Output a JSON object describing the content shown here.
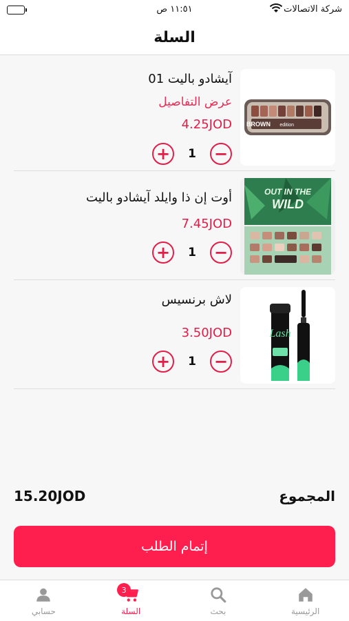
{
  "status_bar": {
    "carrier": "شركة الاتصالات",
    "time": "١١:٥١ ص"
  },
  "header": {
    "title": "السلة"
  },
  "cart_items": [
    {
      "name": "آيشادو باليت 01",
      "details_link": "عرض التفاصيل",
      "price": "4.25JOD",
      "quantity": "1",
      "image": "palette-brown-edition"
    },
    {
      "name": "أوت إن ذا وايلد آيشادو باليت",
      "price": "7.45JOD",
      "quantity": "1",
      "image": "palette-out-in-the-wild"
    },
    {
      "name": "لاش برنسيس",
      "price": "3.50JOD",
      "quantity": "1",
      "image": "lash-princess-mascara"
    }
  ],
  "total": {
    "label": "المجموع",
    "value": "15.20JOD"
  },
  "checkout": {
    "label": "إتمام الطلب"
  },
  "tabs": [
    {
      "label": "الرئيسية",
      "icon": "home-icon",
      "active": false
    },
    {
      "label": "بحث",
      "icon": "search-icon",
      "active": false
    },
    {
      "label": "السلة",
      "icon": "cart-icon",
      "active": true,
      "badge": "3"
    },
    {
      "label": "حسابي",
      "icon": "user-icon",
      "active": false
    }
  ],
  "colors": {
    "accent": "#ff1f4f",
    "price": "#e11d48"
  }
}
